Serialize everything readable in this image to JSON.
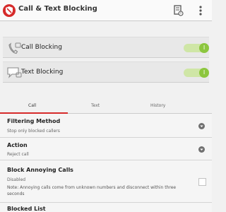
{
  "header": {
    "title": "Call & Text Blocking",
    "logo_icon": "shield-logo-icon",
    "actions": [
      "call-log-icon",
      "overflow-menu-icon"
    ]
  },
  "toggles": [
    {
      "label": "Call Blocking",
      "icon": "phone-icon",
      "state": true
    },
    {
      "label": "Text Blocking",
      "icon": "message-icon",
      "state": true
    }
  ],
  "switch_glyph": "I",
  "tabs": [
    {
      "label": "Call",
      "selected": true
    },
    {
      "label": "Text",
      "selected": false
    },
    {
      "label": "History",
      "selected": false
    }
  ],
  "settings": {
    "filtering": {
      "title": "Filtering Method",
      "value": "Stop only blocked callers"
    },
    "action": {
      "title": "Action",
      "value": "Reject call"
    },
    "annoying": {
      "title": "Block Annoying Calls",
      "value": "Disabled",
      "note": "Note: Annoying calls come from unknown numbers and disconnect within three seconds",
      "checked": false
    },
    "blocked_list": {
      "title": "Blocked List"
    }
  },
  "colors": {
    "accent": "#d62b2b",
    "switch_on": "#8cc63e",
    "switch_track": "#cfe6a6"
  }
}
